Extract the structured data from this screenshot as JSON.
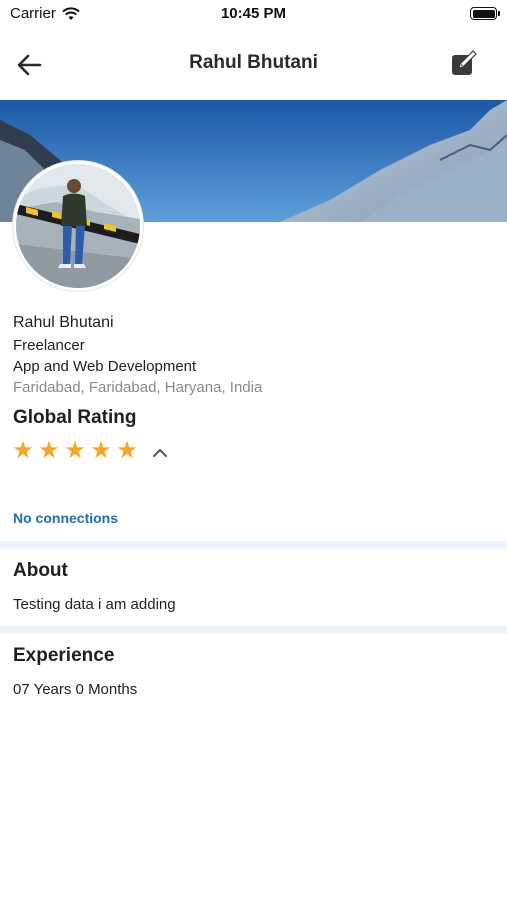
{
  "status_bar": {
    "carrier": "Carrier",
    "time": "10:45 PM",
    "wifi_icon": "wifi-icon",
    "battery_icon": "battery-icon"
  },
  "nav": {
    "title": "Rahul Bhutani",
    "back_icon": "back-arrow-icon",
    "edit_icon": "edit-icon"
  },
  "profile": {
    "name": "Rahul Bhutani",
    "headline": "Freelancer",
    "skills": "App and Web Development",
    "location": "Faridabad, Faridabad, Haryana, India"
  },
  "rating": {
    "title": "Global Rating",
    "stars": 5,
    "star_color": "#f5a623",
    "toggle_icon": "chevron-up-icon"
  },
  "connections": {
    "label": "No connections",
    "color": "#1a6fb5"
  },
  "about": {
    "title": "About",
    "text": "Testing data i am adding"
  },
  "experience": {
    "title": "Experience",
    "text": "07 Years 0 Months"
  },
  "colors": {
    "divider": "#eaf3fb",
    "cover_sky": "#1e5fa8"
  }
}
